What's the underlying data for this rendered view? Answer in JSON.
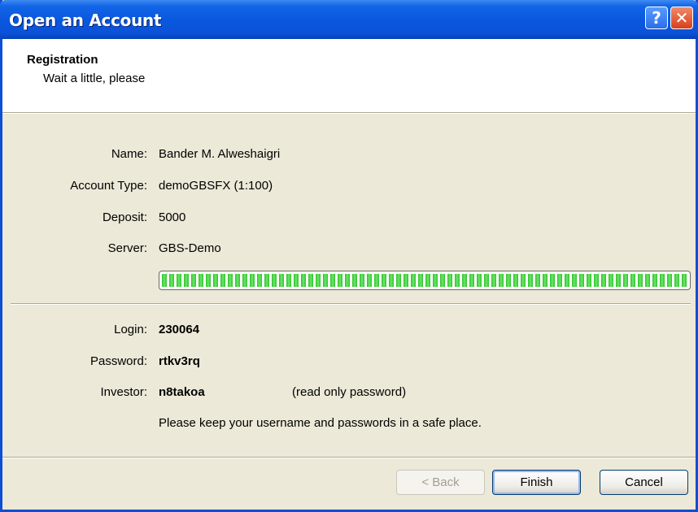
{
  "window": {
    "title": "Open an Account",
    "help_glyph": "?",
    "close_glyph": "✕"
  },
  "header": {
    "title": "Registration",
    "subtitle": "Wait a little, please"
  },
  "fields": {
    "name_label": "Name:",
    "name_value": "Bander M. Alweshaigri",
    "account_type_label": "Account Type:",
    "account_type_value": "demoGBSFX (1:100)",
    "deposit_label": "Deposit:",
    "deposit_value": "5000",
    "server_label": "Server:",
    "server_value": "GBS-Demo"
  },
  "progress": {
    "value_percent": 100
  },
  "credentials": {
    "login_label": "Login:",
    "login_value": "230064",
    "password_label": "Password:",
    "password_value": "rtkv3rq",
    "investor_label": "Investor:",
    "investor_value": "n8takoa",
    "investor_note": "(read only password)",
    "safety_note": "Please keep your username and passwords in a safe place."
  },
  "buttons": {
    "back_label": "< Back",
    "finish_label": "Finish",
    "cancel_label": "Cancel"
  },
  "colors": {
    "titlebar": "#0a58e0",
    "progress_fill": "#2ec32a",
    "dialog_bg": "#ece9d8"
  }
}
